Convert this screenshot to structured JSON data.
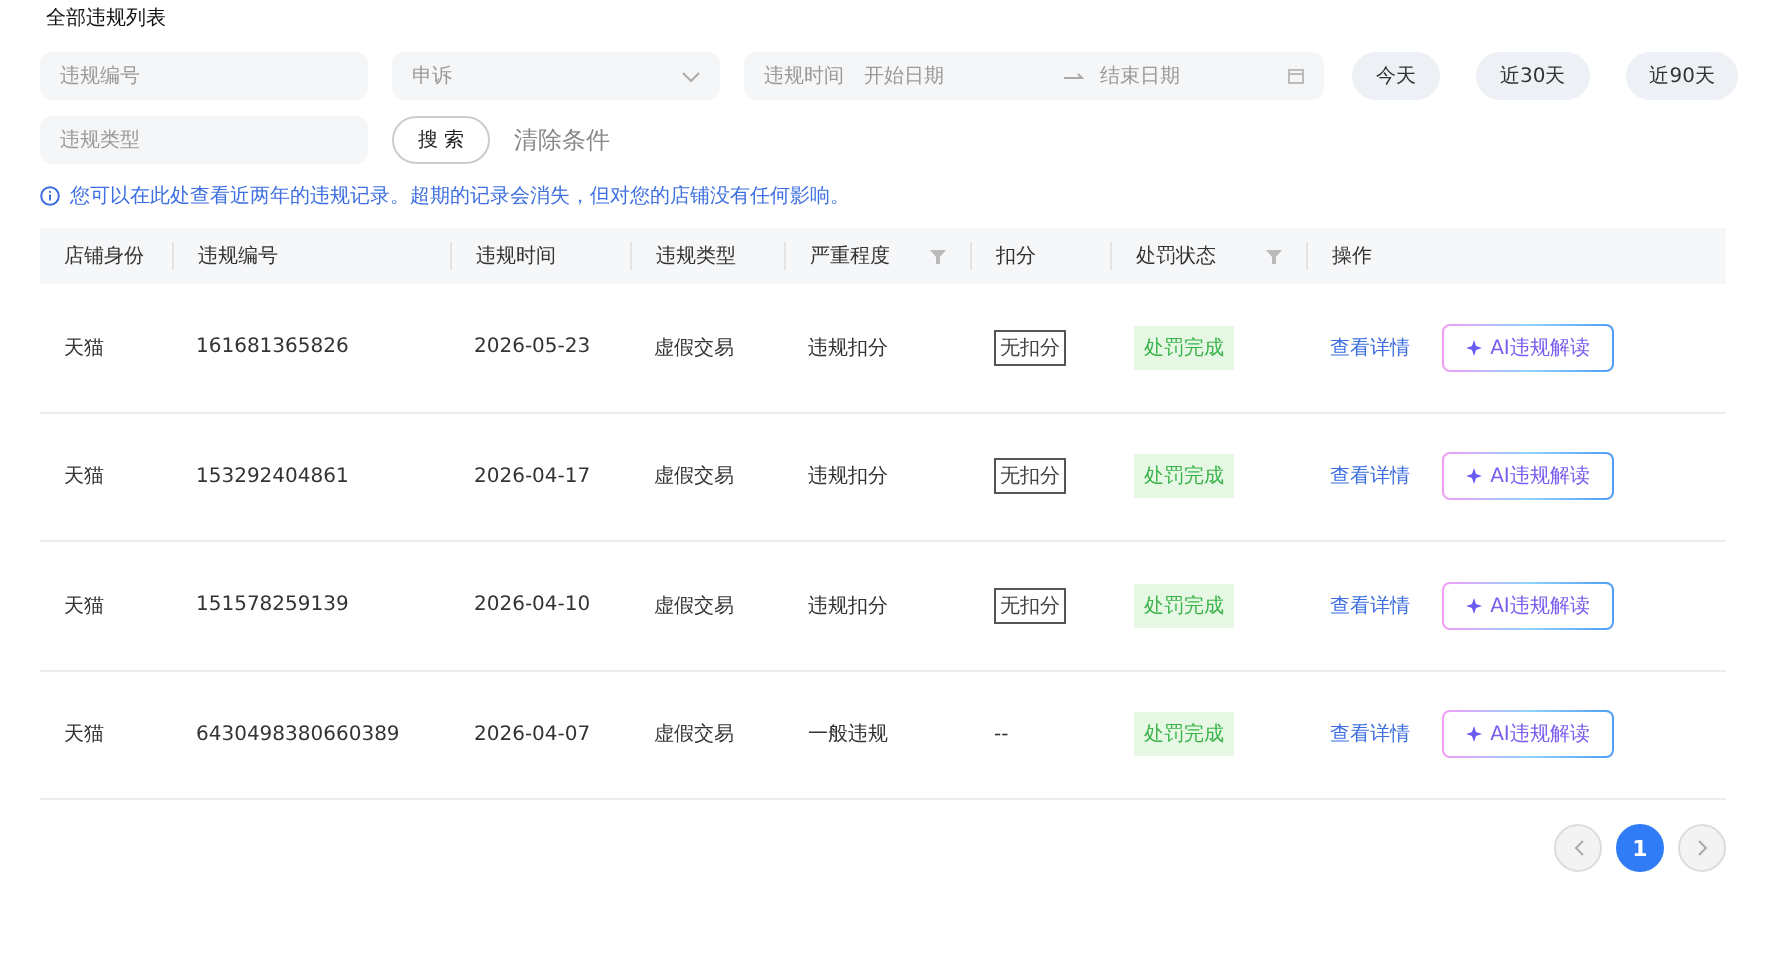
{
  "title": "全部违规列表",
  "filters": {
    "violation_id": {
      "placeholder": "违规编号"
    },
    "appeal": {
      "value": "申诉"
    },
    "date_range": {
      "label": "违规时间",
      "start_placeholder": "开始日期",
      "end_placeholder": "结束日期"
    },
    "quick_ranges": [
      "今天",
      "近30天",
      "近90天"
    ],
    "violation_type": {
      "placeholder": "违规类型"
    },
    "search_button": "搜 索",
    "clear_link": "清除条件"
  },
  "notice": "您可以在此处查看近两年的违规记录。超期的记录会消失，但对您的店铺没有任何影响。",
  "table": {
    "columns": [
      {
        "label": "店铺身份",
        "filter": false
      },
      {
        "label": "违规编号",
        "filter": false
      },
      {
        "label": "违规时间",
        "filter": false
      },
      {
        "label": "违规类型",
        "filter": false
      },
      {
        "label": "严重程度",
        "filter": true
      },
      {
        "label": "扣分",
        "filter": false
      },
      {
        "label": "处罚状态",
        "filter": true
      },
      {
        "label": "操作",
        "filter": false
      }
    ],
    "rows": [
      {
        "shop": "天猫",
        "id": "161681365826",
        "time": "2026-05-23",
        "type": "虚假交易",
        "severity": "违规扣分",
        "deduction": {
          "kind": "tag",
          "text": "无扣分"
        },
        "status": "处罚完成",
        "detail_link": "查看详情",
        "ai_button": "AI违规解读"
      },
      {
        "shop": "天猫",
        "id": "153292404861",
        "time": "2026-04-17",
        "type": "虚假交易",
        "severity": "违规扣分",
        "deduction": {
          "kind": "tag",
          "text": "无扣分"
        },
        "status": "处罚完成",
        "detail_link": "查看详情",
        "ai_button": "AI违规解读"
      },
      {
        "shop": "天猫",
        "id": "151578259139",
        "time": "2026-04-10",
        "type": "虚假交易",
        "severity": "违规扣分",
        "deduction": {
          "kind": "tag",
          "text": "无扣分"
        },
        "status": "处罚完成",
        "detail_link": "查看详情",
        "ai_button": "AI违规解读"
      },
      {
        "shop": "天猫",
        "id": "6430498380660389",
        "time": "2026-04-07",
        "type": "虚假交易",
        "severity": "一般违规",
        "deduction": {
          "kind": "text",
          "text": "--"
        },
        "status": "处罚完成",
        "detail_link": "查看详情",
        "ai_button": "AI违规解读"
      }
    ]
  },
  "pagination": {
    "pages": [
      {
        "label": "1",
        "selected": true
      }
    ]
  }
}
